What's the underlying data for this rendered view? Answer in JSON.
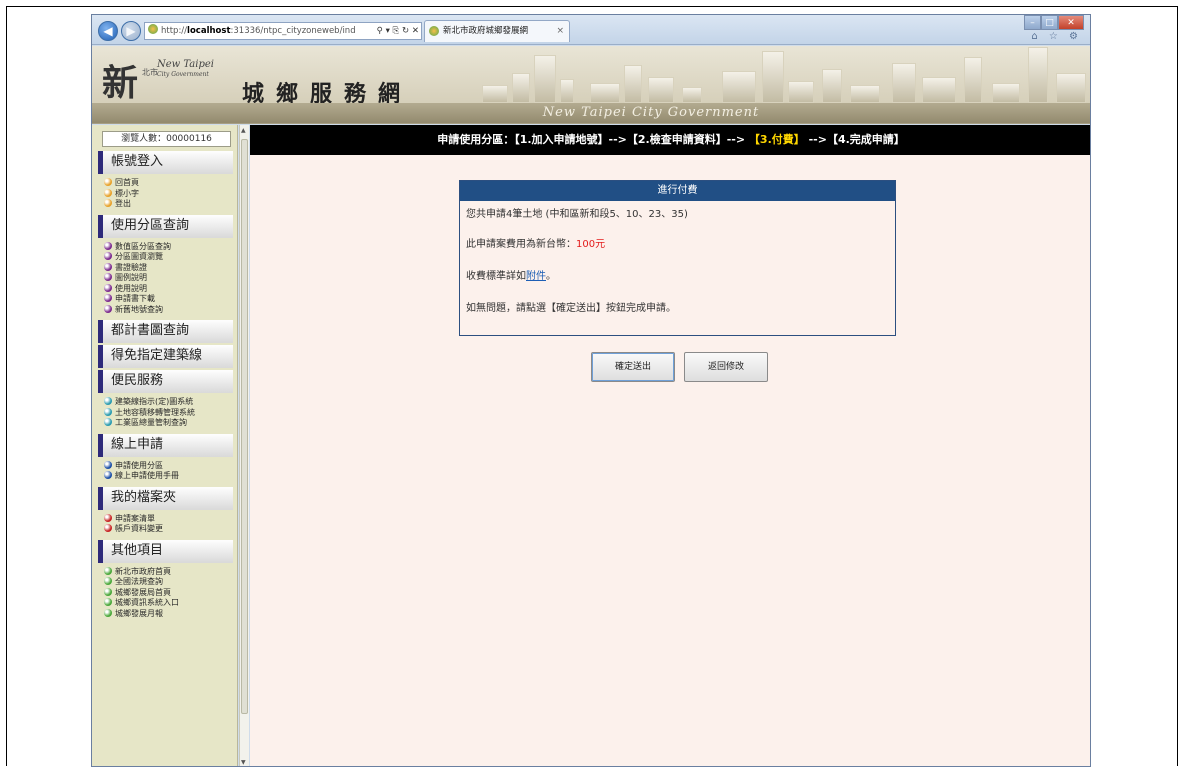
{
  "browser": {
    "address_prefix": "http://",
    "address_host": "localhost",
    "address_rest": ":31336/ntpc_cityzoneweb/ind",
    "address_tools": "⚲ ▾ ⎘ ↻ ✕",
    "tab_title": "新北市政府城鄉發展網",
    "tab_close": "×",
    "right_tools": "⌂ ☆ ⚙",
    "win_min": "–",
    "win_max": "□",
    "win_close": "✕",
    "back_glyph": "◀",
    "fwd_glyph": "▶"
  },
  "header": {
    "logo_big": "新",
    "logo_small": "北市",
    "logo_en_1": "New Taipei",
    "logo_en_2": "City Government",
    "title": "城鄉服務網",
    "subtitle": "New Taipei City Government"
  },
  "sidebar": {
    "counter": "瀏覽人數：00000116",
    "sections": [
      {
        "title": "帳號登入",
        "items": [
          {
            "label": "回首頁",
            "color": "#e8a22a"
          },
          {
            "label": "標小字",
            "color": "#e8a22a"
          },
          {
            "label": "登出",
            "color": "#e8a22a"
          }
        ]
      },
      {
        "title": "使用分區查詢",
        "items": [
          {
            "label": "數值區分區查詢",
            "color": "#7b2a8e"
          },
          {
            "label": "分區圖資瀏覽",
            "color": "#7b2a8e"
          },
          {
            "label": "書證驗證",
            "color": "#7b2a8e"
          },
          {
            "label": "圖例說明",
            "color": "#7b2a8e"
          },
          {
            "label": "使用說明",
            "color": "#7b2a8e"
          },
          {
            "label": "申請書下載",
            "color": "#7b2a8e"
          },
          {
            "label": "新舊地號查詢",
            "color": "#7b2a8e"
          }
        ]
      },
      {
        "title": "都計書圖查詢",
        "items": []
      },
      {
        "title": "得免指定建築線",
        "items": []
      },
      {
        "title": "便民服務",
        "items": [
          {
            "label": "建築線指示(定)圖系統",
            "color": "#2a9bb0"
          },
          {
            "label": "土地容積移轉管理系統",
            "color": "#2a9bb0"
          },
          {
            "label": "工業區總量管制查詢",
            "color": "#2a9bb0"
          }
        ]
      },
      {
        "title": "線上申請",
        "items": [
          {
            "label": "申請使用分區",
            "color": "#1d4fa6"
          },
          {
            "label": "線上申請使用手冊",
            "color": "#1d4fa6"
          }
        ]
      },
      {
        "title": "我的檔案夾",
        "items": [
          {
            "label": "申請案清單",
            "color": "#c72222"
          },
          {
            "label": "帳戶資料變更",
            "color": "#c72222"
          }
        ]
      },
      {
        "title": "其他項目",
        "items": [
          {
            "label": "新北市政府首頁",
            "color": "#4aa83a"
          },
          {
            "label": "全國法規查詢",
            "color": "#4aa83a"
          },
          {
            "label": "城鄉發展局首頁",
            "color": "#4aa83a"
          },
          {
            "label": "城鄉資訊系統入口",
            "color": "#4aa83a"
          },
          {
            "label": "城鄉發展月報",
            "color": "#4aa83a"
          }
        ]
      }
    ]
  },
  "steps": {
    "prefix": "申請使用分區：【1.加入申請地號】-->【2.檢查申請資料】--> ",
    "current": "【3.付費】",
    "suffix": " -->【4.完成申請】"
  },
  "payment": {
    "title": "進行付費",
    "line1": "您共申請4筆土地 (中和區新和段5、10、23、35)",
    "line2_prefix": "此申請案費用為新台幣：",
    "line2_amount": "100元",
    "line3_prefix": "收費標準詳如",
    "line3_link": "附件",
    "line3_suffix": "。",
    "line4": "如無問題，請點選【確定送出】按鈕完成申請。"
  },
  "buttons": {
    "submit": "確定送出",
    "back": "返回修改"
  },
  "colors": {
    "stepbar_bg": "#000000",
    "current_step": "#ffd700",
    "paybox_header": "#214f85",
    "amount": "#e31b1b"
  }
}
